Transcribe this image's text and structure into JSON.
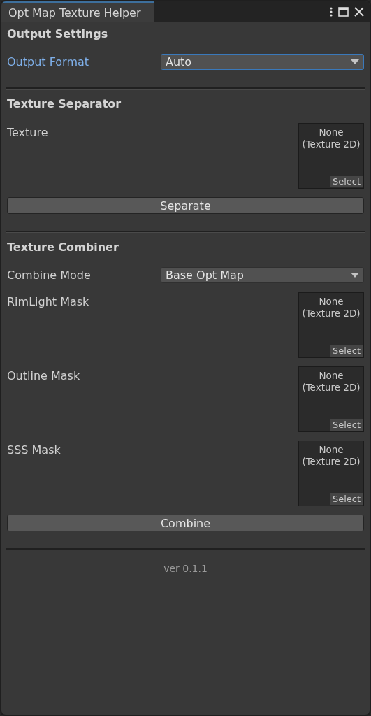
{
  "window": {
    "title": "Opt Map Texture Helper"
  },
  "sections": [
    {
      "title": "Output Settings",
      "fields": [
        {
          "kind": "dropdown",
          "label": "Output Format",
          "value": "Auto",
          "focused": true
        }
      ]
    },
    {
      "title": "Texture Separator",
      "fields": [
        {
          "kind": "texture",
          "label": "Texture",
          "value": "None",
          "type": "(Texture 2D)",
          "select": "Select"
        }
      ],
      "button": "Separate"
    },
    {
      "title": "Texture Combiner",
      "fields": [
        {
          "kind": "dropdown",
          "label": "Combine Mode",
          "value": "Base Opt Map",
          "focused": false
        },
        {
          "kind": "texture",
          "label": "RimLight Mask",
          "value": "None",
          "type": "(Texture 2D)",
          "select": "Select"
        },
        {
          "kind": "texture",
          "label": "Outline Mask",
          "value": "None",
          "type": "(Texture 2D)",
          "select": "Select"
        },
        {
          "kind": "texture",
          "label": "SSS Mask",
          "value": "None",
          "type": "(Texture 2D)",
          "select": "Select"
        }
      ],
      "button": "Combine"
    }
  ],
  "version": "ver 0.1.1"
}
